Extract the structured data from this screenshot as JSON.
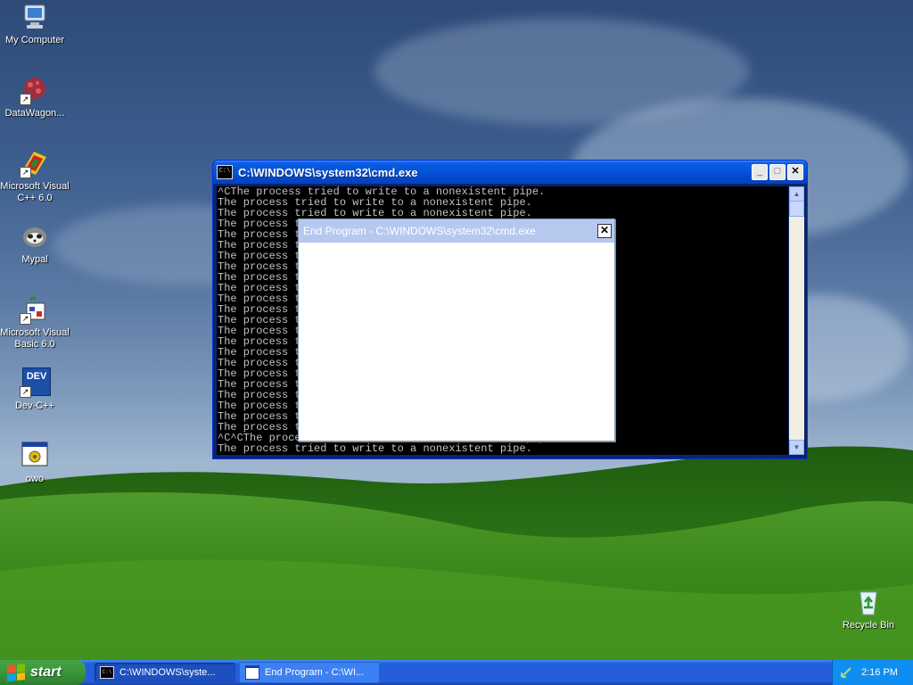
{
  "desktop": {
    "icons": [
      {
        "label": "My Computer"
      },
      {
        "label": "DataWagon..."
      },
      {
        "label": "Microsoft Visual C++ 6.0"
      },
      {
        "label": "Mypal"
      },
      {
        "label": "Microsoft Visual Basic 6.0"
      },
      {
        "label": "Dev-C++"
      },
      {
        "label": "owo"
      },
      {
        "label": "Recycle Bin"
      }
    ],
    "dev_badge": "DEV"
  },
  "cmd_window": {
    "title": "C:\\WINDOWS\\system32\\cmd.exe",
    "icon_text": "C:\\",
    "lines": [
      "^CThe process tried to write to a nonexistent pipe.",
      "The process tried to write to a nonexistent pipe.",
      "The process tried to write to a nonexistent pipe.",
      "The process tried to write to a nonexistent pipe.",
      "The process tried to write to a nonexistent pipe.",
      "The process tried to write to a nonexistent pipe.",
      "The process tried to write to a nonexistent pipe.",
      "The process tried to write to a nonexistent pipe.",
      "The process tried to write to a nonexistent pipe.",
      "The process tried to write to a nonexistent pipe.",
      "The process tried to write to a nonexistent pipe.",
      "The process tried to write to a nonexistent pipe.",
      "The process tried to write to a nonexistent pipe.",
      "The process tried to write to a nonexistent pipe.",
      "The process tried to write to a nonexistent pipe.",
      "The process tried to write to a nonexistent pipe.",
      "The process tried to write to a nonexistent pipe.",
      "The process tried to write to a nonexistent pipe.",
      "The process tried to write to a nonexistent pipe.",
      "The process tried to write to a nonexistent pipe.",
      "The process tried to write to a nonexistent pipe.",
      "The process tried to write to a nonexistent pipe.",
      "The process tried to write to a nonexistent pipe.",
      "^C^CThe process tried to write to a nonexistent pipe.",
      "The process tried to write to a nonexistent pipe."
    ]
  },
  "end_program_dialog": {
    "title": "End Program - C:\\WINDOWS\\system32\\cmd.exe",
    "close_glyph": "✕"
  },
  "taskbar": {
    "start_label": "start",
    "tasks": [
      {
        "label": "C:\\WINDOWS\\syste..."
      },
      {
        "label": "End Program - C:\\WI..."
      }
    ],
    "clock": "2:16 PM"
  }
}
